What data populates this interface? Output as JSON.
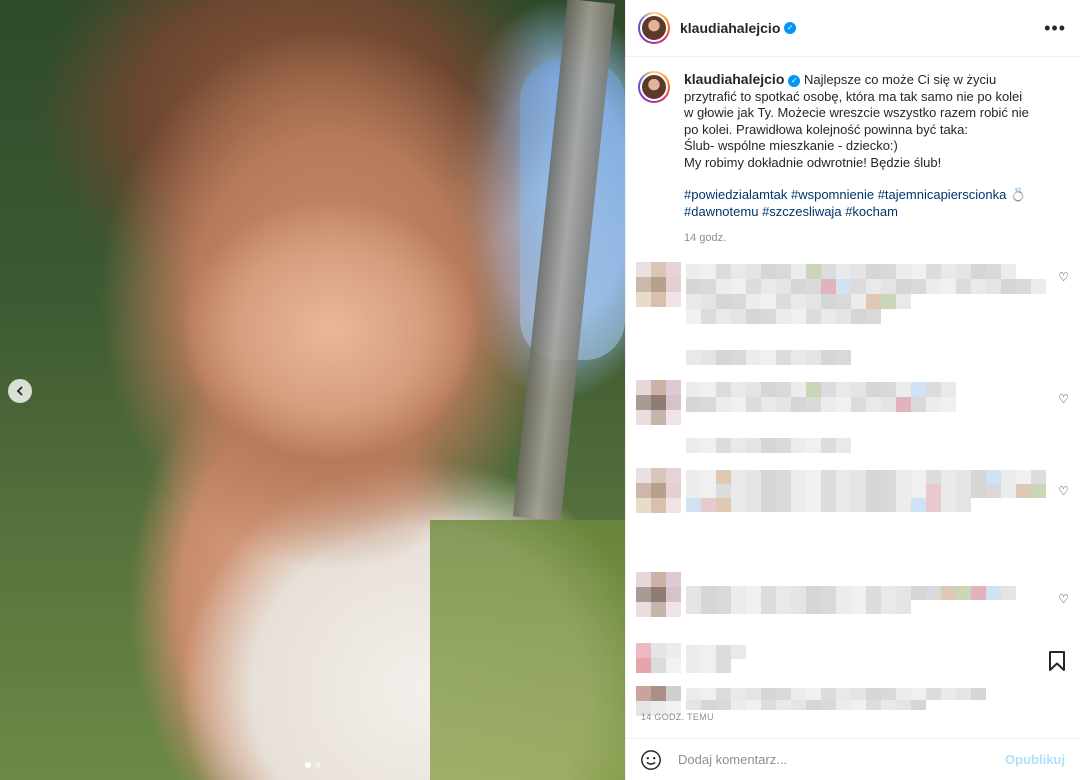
{
  "post": {
    "carousel": {
      "slide_count": 2,
      "active_slide": 1
    },
    "header": {
      "username": "klaudiahalejcio",
      "more_icon": "more-options-icon"
    },
    "caption": {
      "username": "klaudiahalejcio",
      "lines": [
        "Najlepsze co może Ci się w życiu przytrafić to",
        "spotkać osobę, która ma tak samo nie po kolei w głowie jak Ty.",
        "Możecie wreszcie wszystko razem robić nie po kolei. Prawidłowa",
        "kolejność powinna być taka:",
        "Ślub- wspólne mieszkanie - dziecko:)",
        "My robimy dokładnie odwrotnie! Będzie ślub!"
      ],
      "hashtags_line1": [
        "#powiedzialamtak",
        "#wspomnienie",
        "#tajemnicapierscionka",
        "💍"
      ],
      "hashtags_line2": [
        "#dawnotemu",
        "#szczesliwaja",
        "#kocham"
      ],
      "time": "14 godz."
    },
    "post_time": "14 GODZ. TEMU",
    "comment_box": {
      "placeholder": "Dodaj komentarz...",
      "publish_label": "Opublikuj"
    }
  },
  "colors": {
    "link": "#00376b",
    "verified": "#0095f6",
    "publish_disabled": "#b2dffc",
    "muted": "#8e8e8e"
  }
}
